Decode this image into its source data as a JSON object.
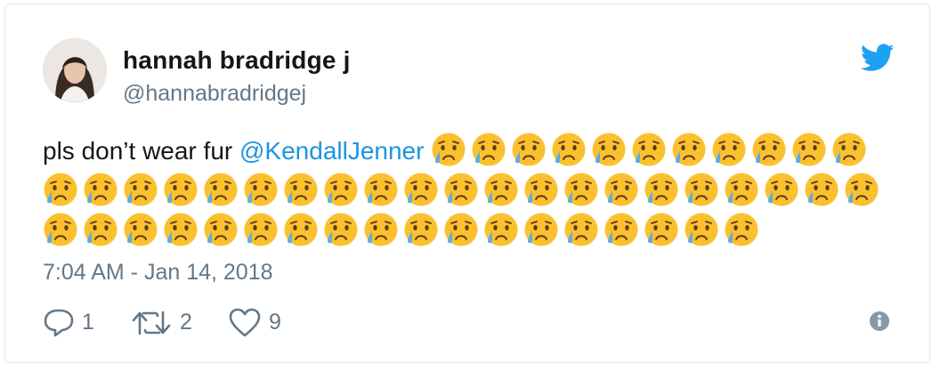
{
  "tweet": {
    "author_name": "hannah bradridge j",
    "author_handle": "@hannabradridgej",
    "text_prefix": "pls don’t wear fur",
    "mention": "@KendallJenner",
    "emoji_icon": "crying-face-emoji",
    "emoji_count": 50,
    "timestamp": "7:04 AM - Jan 14, 2018"
  },
  "actions": {
    "reply_count": "1",
    "retweet_count": "2",
    "like_count": "9"
  },
  "colors": {
    "mention": "#1b95e0",
    "muted": "#657786",
    "twitter_blue": "#1da1f2",
    "emoji_face": "#fbc02d",
    "emoji_tear": "#5dade2"
  }
}
